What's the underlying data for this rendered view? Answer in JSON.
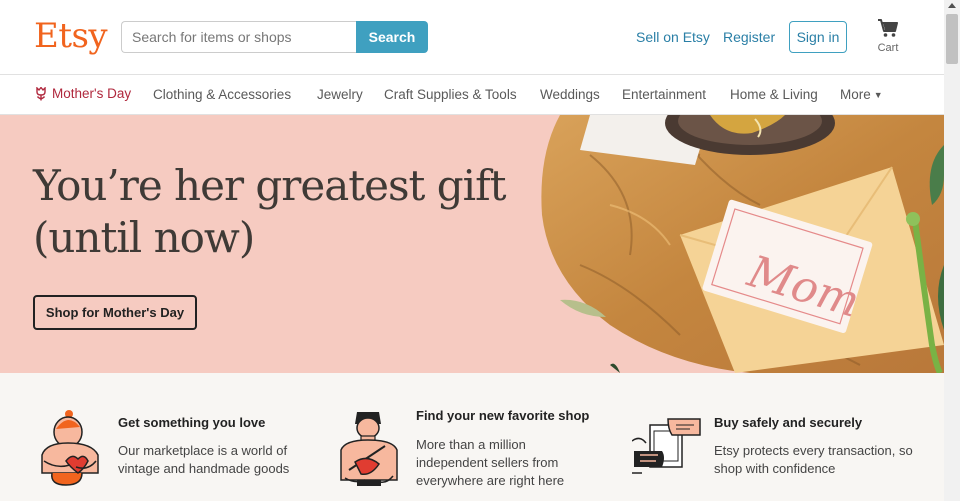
{
  "header": {
    "logo": "Etsy",
    "search_placeholder": "Search for items or shops",
    "search_button": "Search",
    "sell_link": "Sell on Etsy",
    "register_link": "Register",
    "signin_button": "Sign in",
    "cart_label": "Cart"
  },
  "nav": {
    "items": [
      {
        "label": "Mother's Day",
        "icon": "tulip-icon"
      },
      {
        "label": "Clothing & Accessories"
      },
      {
        "label": "Jewelry"
      },
      {
        "label": "Craft Supplies & Tools"
      },
      {
        "label": "Weddings"
      },
      {
        "label": "Entertainment"
      },
      {
        "label": "Home & Living"
      },
      {
        "label": "More"
      }
    ]
  },
  "hero": {
    "title": "You’re her greatest gift (until now)",
    "button": "Shop for Mother's Day",
    "card_text": "Mom",
    "background": "#f6cbc1"
  },
  "props": [
    {
      "title": "Get something you love",
      "text": "Our marketplace is a world of vintage and handmade goods",
      "icon": "person-holding-heart-icon"
    },
    {
      "title": "Find your new favorite shop",
      "text": "More than a million independent sellers from everywhere are right here",
      "icon": "seller-crafting-icon"
    },
    {
      "title": "Buy safely and securely",
      "text": "Etsy protects every transaction, so shop with confidence",
      "icon": "secure-card-hands-icon"
    }
  ],
  "colors": {
    "brand": "#f1641e",
    "accent": "#3fa0c0",
    "link": "#2a7fa6",
    "mothers_day": "#b0283d"
  }
}
